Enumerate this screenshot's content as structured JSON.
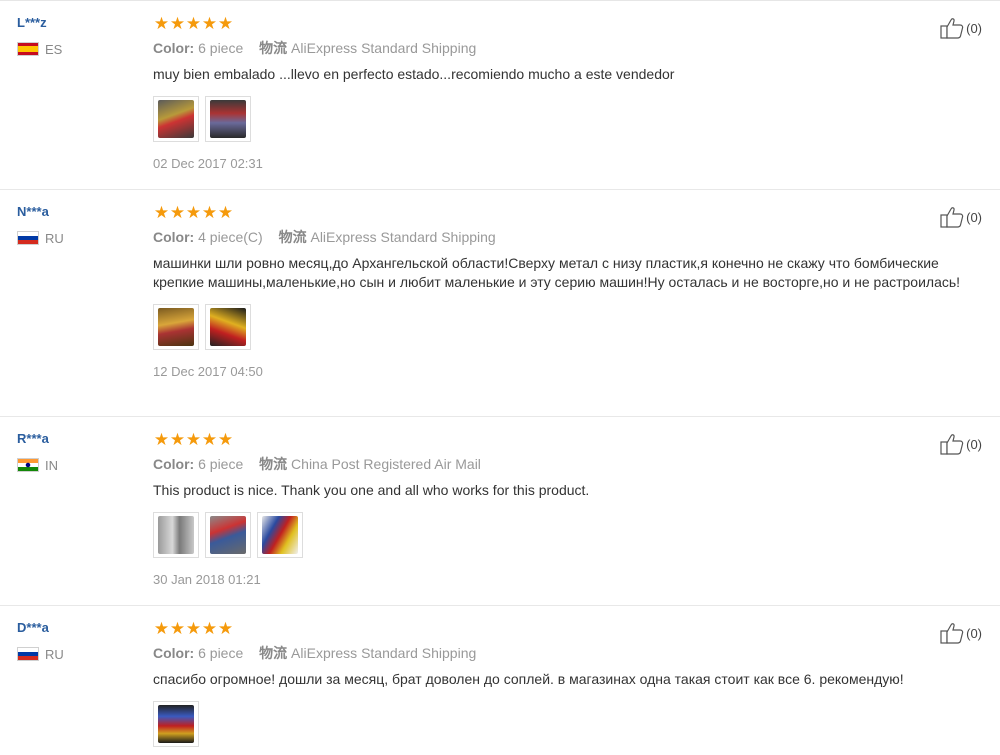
{
  "colors": {
    "username": "#2a5d9e",
    "star": "#f59a0c",
    "meta_text": "#999999"
  },
  "icons": {
    "star": "star-icon",
    "like": "thumbs-up-icon"
  },
  "labels": {
    "color": "Color:",
    "shipping": "物流"
  },
  "reviews": [
    {
      "user": "L***z",
      "country": "ES",
      "rating": 5,
      "color_value": "6 piece",
      "shipping_value": "AliExpress Standard Shipping",
      "text": "muy bien embalado ...llevo en perfecto estado...recomiendo mucho a este vendedor",
      "photo_count": 2,
      "date": "02 Dec 2017 02:31",
      "useful_count": "(0)"
    },
    {
      "user": "N***a",
      "country": "RU",
      "rating": 5,
      "color_value": "4 piece(C)",
      "shipping_value": "AliExpress Standard Shipping",
      "text": "машинки шли ровно месяц,до Архангельской области!Сверху метал с низу пластик,я конечно не скажу что бомбические крепкие машины,маленькие,но сын и любит маленькие и эту серию машин!Ну осталась и не восторге,но и не растроилась!",
      "photo_count": 2,
      "date": "12 Dec 2017 04:50",
      "useful_count": "(0)"
    },
    {
      "user": "R***a",
      "country": "IN",
      "rating": 5,
      "color_value": "6 piece",
      "shipping_value": "China Post Registered Air Mail",
      "text": "This product is nice. Thank you one and all who works for this product.",
      "photo_count": 3,
      "date": "30 Jan 2018 01:21",
      "useful_count": "(0)"
    },
    {
      "user": "D***a",
      "country": "RU",
      "rating": 5,
      "color_value": "6 piece",
      "shipping_value": "AliExpress Standard Shipping",
      "text": "спасибо огромное! дошли за месяц, брат доволен до соплей. в магазинах одна такая стоит как все 6. рекомендую!",
      "photo_count": 1,
      "date": "",
      "useful_count": "(0)"
    }
  ]
}
